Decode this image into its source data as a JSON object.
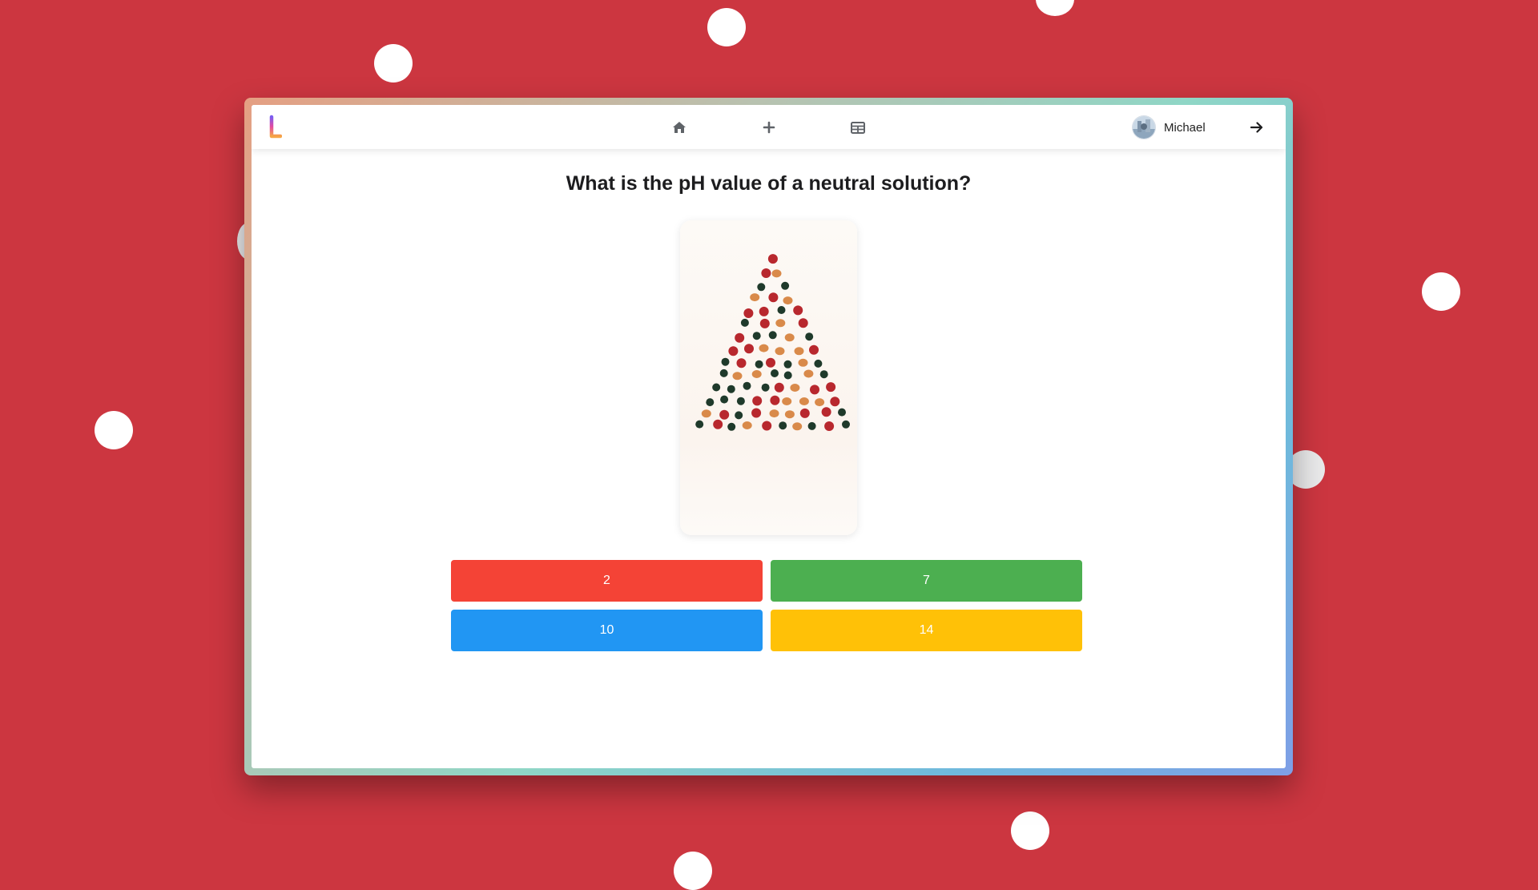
{
  "navbar": {
    "logo_icon": "app-logo-icon",
    "home_icon": "home-icon",
    "add_icon": "plus-icon",
    "table_icon": "table-icon",
    "user": {
      "name": "Michael",
      "avatar_icon": "avatar"
    },
    "logout_icon": "arrow-right-icon"
  },
  "quiz": {
    "question": "What is the pH value of a neutral solution?",
    "image": "christmas-tree-berries-image",
    "answers": [
      {
        "label": "2",
        "color": "#f44336"
      },
      {
        "label": "7",
        "color": "#4caf50"
      },
      {
        "label": "10",
        "color": "#2196f3"
      },
      {
        "label": "14",
        "color": "#ffc107"
      }
    ]
  },
  "theme": {
    "background": "#cc3640",
    "frame_gradient": [
      "#e59f82",
      "#8fd6c6",
      "#6fb9dc",
      "#7e9fe6"
    ]
  }
}
